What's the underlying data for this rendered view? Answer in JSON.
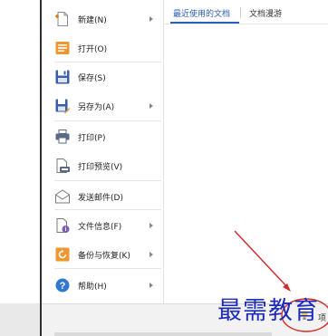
{
  "menu": {
    "items": [
      {
        "label": "新建(N)",
        "icon": "new-document-icon",
        "has_submenu": true
      },
      {
        "label": "打开(O)",
        "icon": "open-folder-icon",
        "has_submenu": false
      },
      {
        "label": "保存(S)",
        "icon": "save-icon",
        "has_submenu": false
      },
      {
        "label": "另存为(A)",
        "icon": "save-as-icon",
        "has_submenu": true
      },
      {
        "label": "打印(P)",
        "icon": "printer-icon",
        "has_submenu": false
      },
      {
        "label": "打印预览(V)",
        "icon": "print-preview-icon",
        "has_submenu": false
      },
      {
        "label": "发送邮件(D)",
        "icon": "mail-icon",
        "has_submenu": false
      },
      {
        "label": "文件信息(F)",
        "icon": "file-info-icon",
        "has_submenu": true
      },
      {
        "label": "备份与恢复(K)",
        "icon": "backup-restore-icon",
        "has_submenu": true
      },
      {
        "label": "帮助(H)",
        "icon": "help-icon",
        "has_submenu": true
      }
    ]
  },
  "tabs": {
    "recent": "最近使用的文档",
    "roaming": "文档漫游"
  },
  "watermark": {
    "text": "最需教育"
  },
  "bottom": {
    "suffix": "项"
  },
  "colors": {
    "accent_blue": "#2a5fb8",
    "watermark_blue": "#1d2bb8",
    "annotation_red": "#d6282a"
  }
}
